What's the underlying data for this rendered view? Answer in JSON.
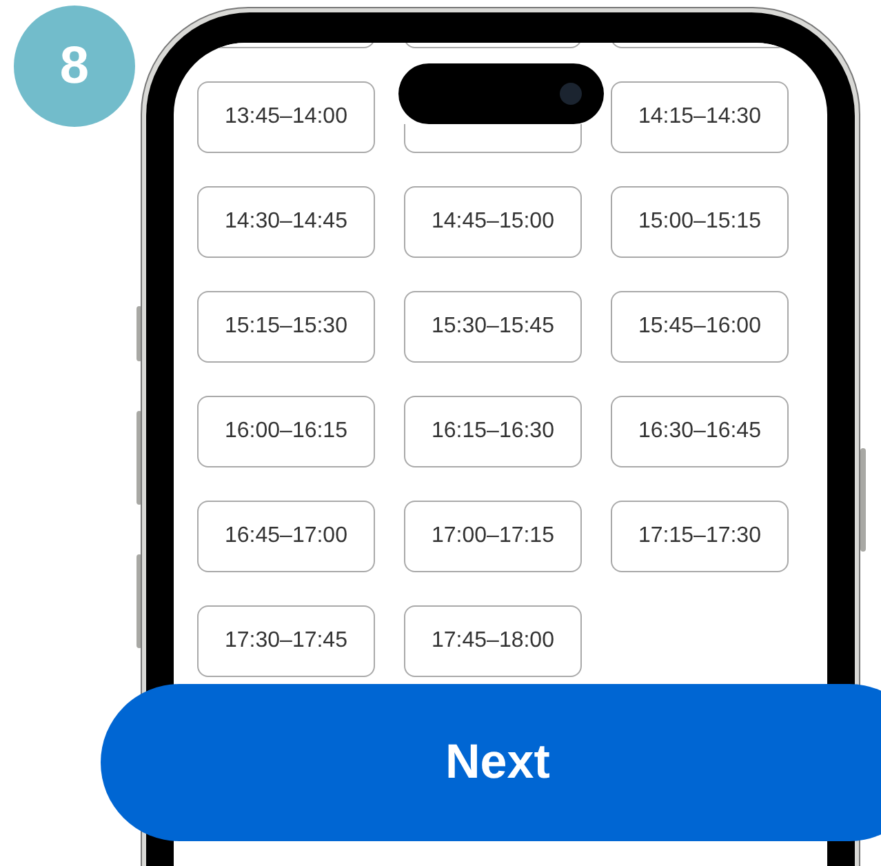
{
  "step_badge": "8",
  "time_slots": [
    {
      "kind": "partial"
    },
    {
      "kind": "partial"
    },
    {
      "kind": "partial"
    },
    {
      "label": "13:45–14:00"
    },
    {
      "kind": "covered"
    },
    {
      "label": "14:15–14:30"
    },
    {
      "label": "14:30–14:45"
    },
    {
      "label": "14:45–15:00"
    },
    {
      "label": "15:00–15:15"
    },
    {
      "label": "15:15–15:30"
    },
    {
      "label": "15:30–15:45"
    },
    {
      "label": "15:45–16:00"
    },
    {
      "label": "16:00–16:15"
    },
    {
      "label": "16:15–16:30"
    },
    {
      "label": "16:30–16:45"
    },
    {
      "label": "16:45–17:00"
    },
    {
      "label": "17:00–17:15"
    },
    {
      "label": "17:15–17:30"
    },
    {
      "label": "17:30–17:45"
    },
    {
      "label": "17:45–18:00"
    }
  ],
  "next_button": "Next"
}
